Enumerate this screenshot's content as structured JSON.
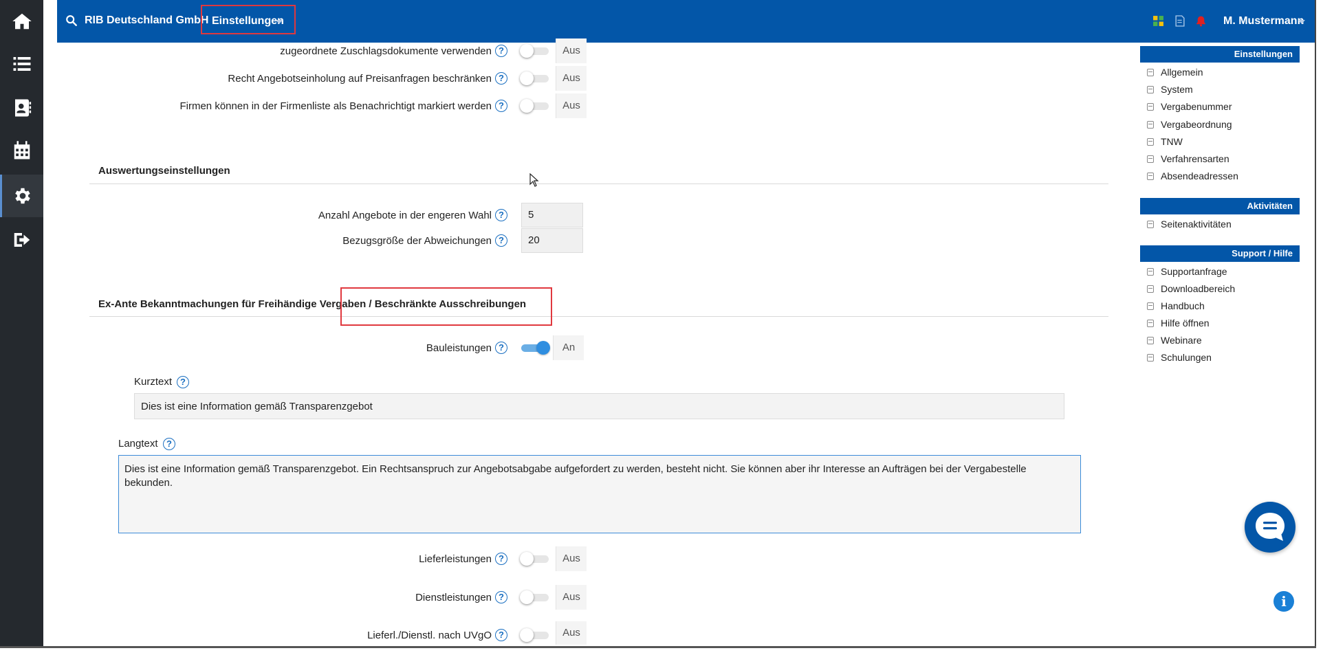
{
  "topbar": {
    "company": "RIB Deutschland GmbH",
    "menu_label": "Einstellungen",
    "user": "M. Mustermann"
  },
  "rail": {
    "icons": [
      "home-icon",
      "list-icon",
      "contacts-icon",
      "calendar-icon",
      "settings-icon",
      "logout-icon"
    ],
    "active": "settings-icon"
  },
  "general": {
    "rows": [
      {
        "label": "zugeordnete Zuschlagsdokumente verwenden",
        "state": "Aus"
      },
      {
        "label": "Recht Angebotseinholung auf Preisanfragen beschränken",
        "state": "Aus"
      },
      {
        "label": "Firmen können in der Firmenliste als Benachrichtigt markiert werden",
        "state": "Aus"
      }
    ]
  },
  "auswertung": {
    "title": "Auswertungseinstellungen",
    "rows": [
      {
        "label": "Anzahl Angebote in der engeren Wahl",
        "value": "5"
      },
      {
        "label": "Bezugsgröße der Abweichungen",
        "value": "20"
      }
    ]
  },
  "exante": {
    "title": "Ex-Ante Bekanntmachungen für Freihändige Vergaben / Beschränkte Ausschreibungen",
    "bau": {
      "label": "Bauleistungen",
      "state": "An"
    },
    "kurztext_label": "Kurztext",
    "kurztext_value": "Dies ist eine Information gemäß Transparenzgebot",
    "langtext_label": "Langtext",
    "langtext_value": "Dies ist eine Information gemäß Transparenzgebot. Ein Rechtsanspruch zur Angebotsabgabe aufgefordert zu werden, besteht nicht. Sie können aber ihr Interesse an Aufträgen bei der Vergabestelle bekunden.",
    "rows": [
      {
        "label": "Lieferleistungen",
        "state": "Aus"
      },
      {
        "label": "Dienstleistungen",
        "state": "Aus"
      },
      {
        "label": "Lieferl./Dienstl. nach UVgO",
        "state": "Aus"
      }
    ]
  },
  "sidebar": {
    "einstellungen": {
      "title": "Einstellungen",
      "items": [
        "Allgemein",
        "System",
        "Vergabenummer",
        "Vergabeordnung",
        "TNW",
        "Verfahrensarten",
        "Absendeadressen"
      ]
    },
    "aktivitaeten": {
      "title": "Aktivitäten",
      "items": [
        "Seitenaktivitäten"
      ]
    },
    "support": {
      "title": "Support / Hilfe",
      "items": [
        "Supportanfrage",
        "Downloadbereich",
        "Handbuch",
        "Hilfe öffnen",
        "Webinare",
        "Schulungen"
      ]
    }
  },
  "colors": {
    "brand_blue": "#0356a8",
    "highlight_red": "#e0383e",
    "toggle_on": "#2f8ee0"
  }
}
